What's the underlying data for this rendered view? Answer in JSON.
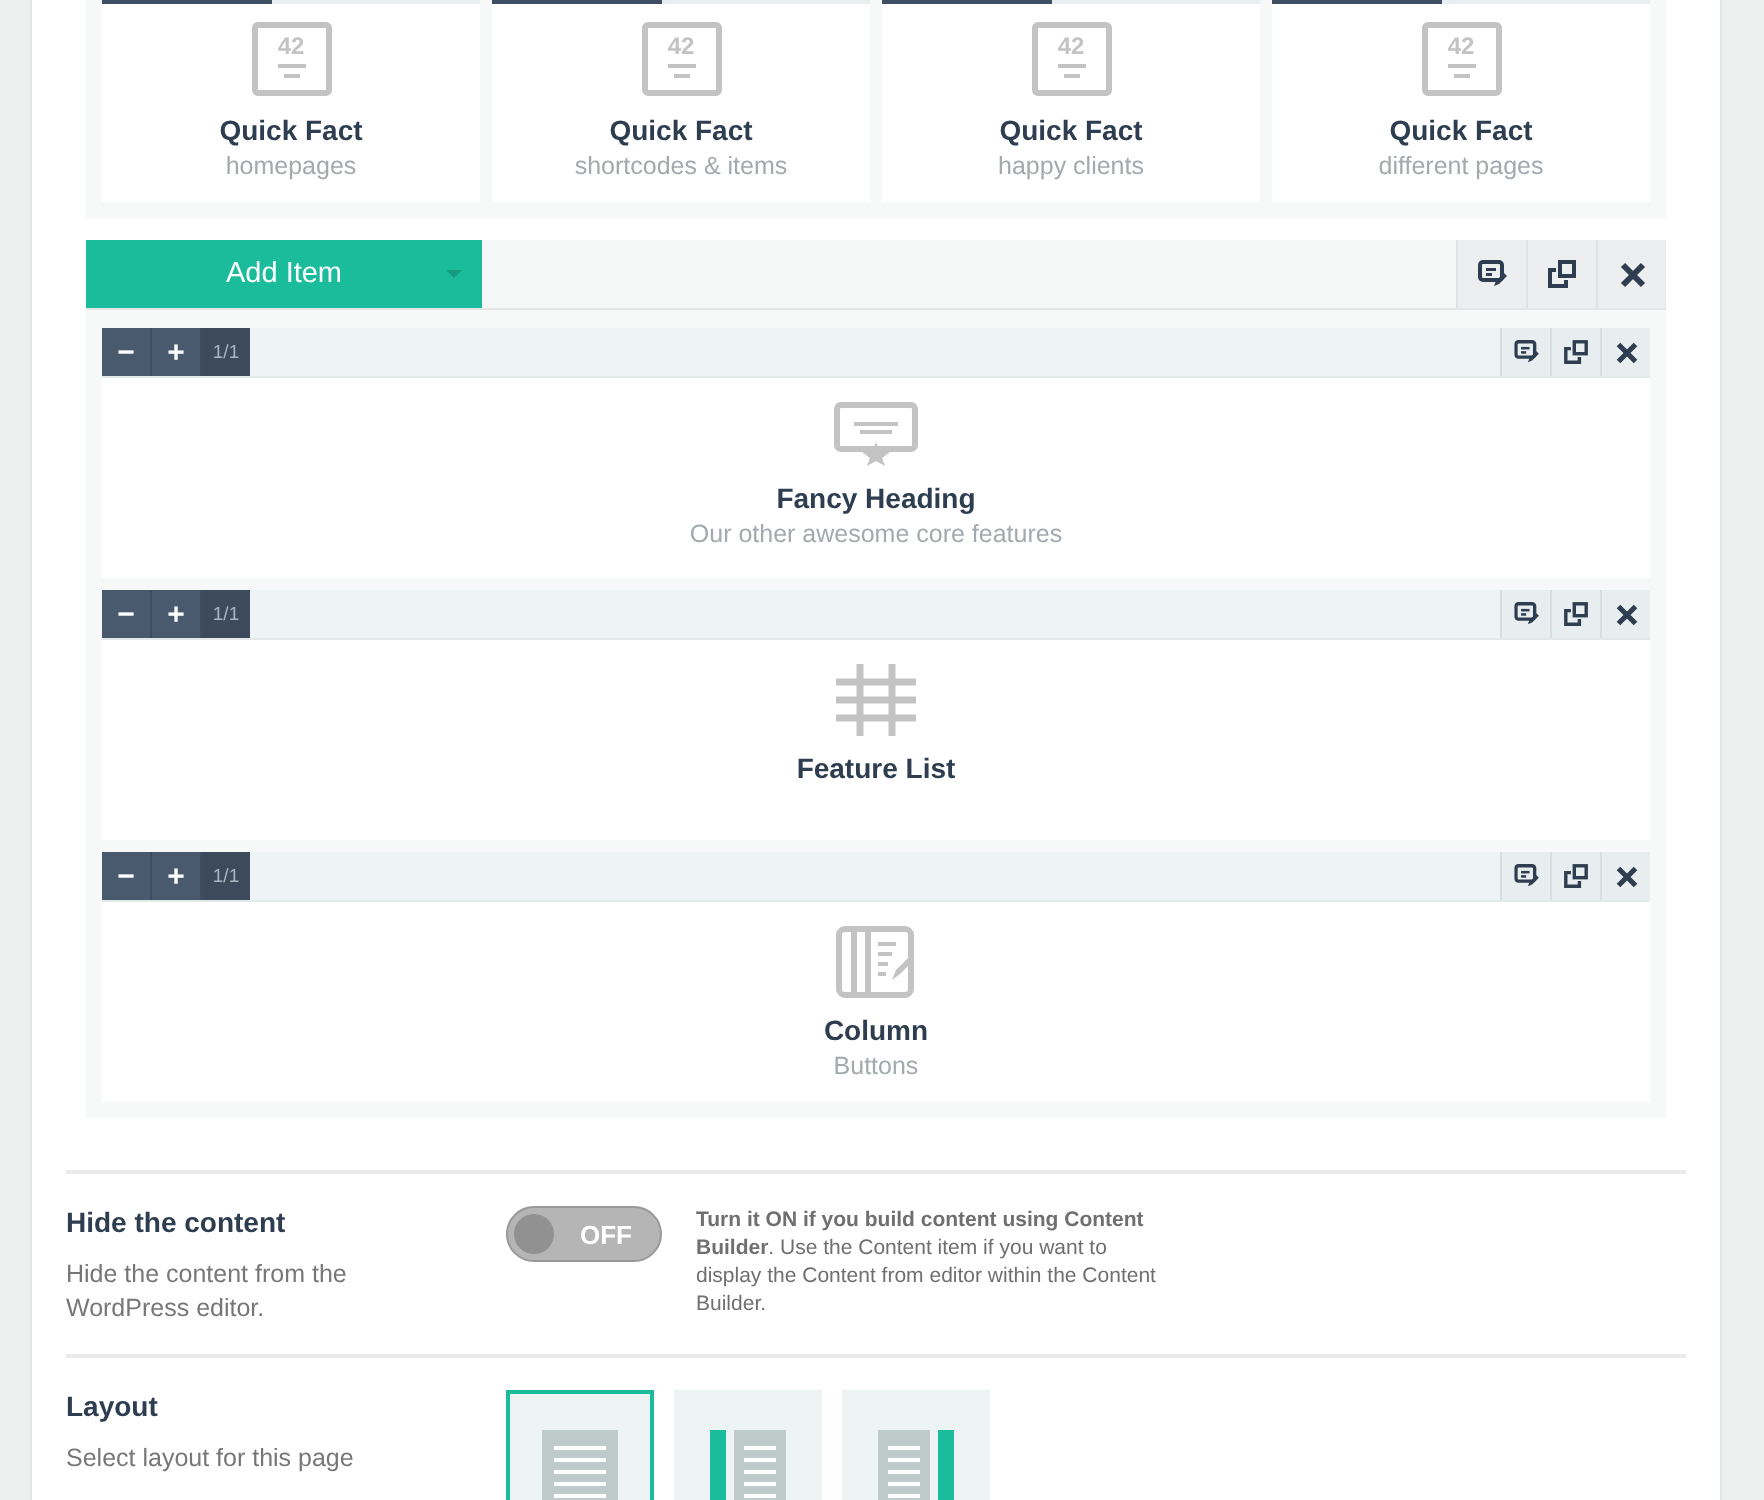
{
  "quick_facts": [
    {
      "icon_text": "42",
      "title": "Quick Fact",
      "subtitle": "homepages"
    },
    {
      "icon_text": "42",
      "title": "Quick Fact",
      "subtitle": "shortcodes & items"
    },
    {
      "icon_text": "42",
      "title": "Quick Fact",
      "subtitle": "happy clients"
    },
    {
      "icon_text": "42",
      "title": "Quick Fact",
      "subtitle": "different pages"
    }
  ],
  "add_item_button": {
    "label": "Add Item"
  },
  "items": [
    {
      "kind": "heading",
      "decrease": "−",
      "increase": "+",
      "counter": "1/1",
      "title": "Fancy Heading",
      "subtitle": "Our other awesome core features"
    },
    {
      "kind": "list",
      "decrease": "−",
      "increase": "+",
      "counter": "1/1",
      "title": "Feature List"
    },
    {
      "kind": "column",
      "decrease": "−",
      "increase": "+",
      "counter": "1/1",
      "title": "Column",
      "subtitle": "Buttons"
    }
  ],
  "options": [
    {
      "kind": "toggle",
      "title": "Hide the content",
      "description": "Hide the content from the WordPress editor.",
      "toggle": {
        "label": "OFF",
        "on": false
      },
      "help": "**Turn it ON if you build content using Content Builder**. Use the Content item if you want to display the Content from editor within the Content Builder."
    },
    {
      "kind": "layout",
      "title": "Layout",
      "description": "Select layout for this page",
      "layouts": [
        {
          "kind": "full",
          "selected": true
        },
        {
          "kind": "left-sidebar",
          "selected": false
        },
        {
          "kind": "right-sidebar",
          "selected": false
        }
      ]
    }
  ]
}
